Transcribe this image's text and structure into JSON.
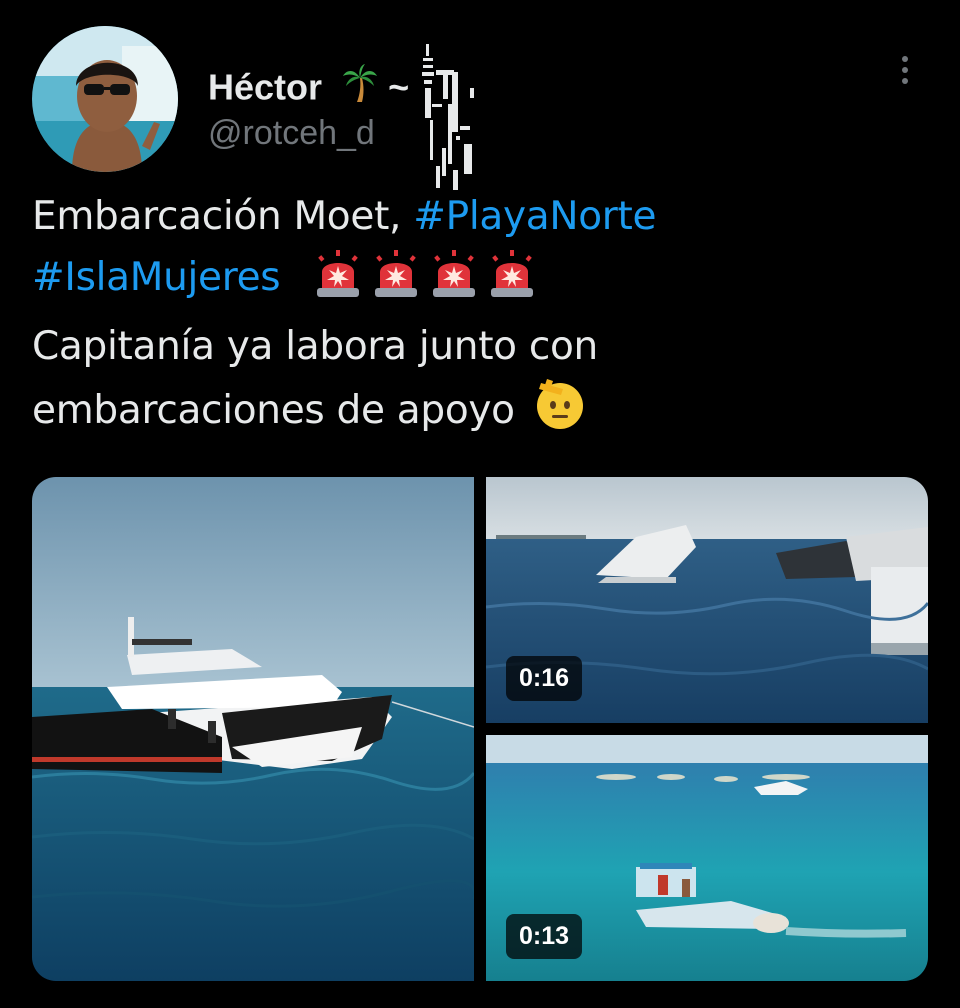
{
  "tweet": {
    "author": {
      "display_name": "Héctor",
      "handle": "@rotceh_d",
      "name_emoji_icon": "palm-tree-icon",
      "name_suffix": "~"
    },
    "text": {
      "line1_plain": "Embarcación Moet, ",
      "hashtag1": "#PlayaNorte",
      "hashtag2": "#IslaMujeres",
      "rotating_light_icon": "rotating-light-icon",
      "line3": "Capitanía ya labora junto con",
      "line4": "embarcaciones de apoyo",
      "saluting_face_icon": "saluting-face-icon"
    },
    "media": [
      {
        "kind": "image",
        "subject": "yacht"
      },
      {
        "kind": "video",
        "duration": "0:16"
      },
      {
        "kind": "video",
        "duration": "0:13"
      }
    ]
  },
  "colors": {
    "background": "#000000",
    "text": "#e7e9ea",
    "secondary": "#71767b",
    "link": "#1d9bf0"
  }
}
